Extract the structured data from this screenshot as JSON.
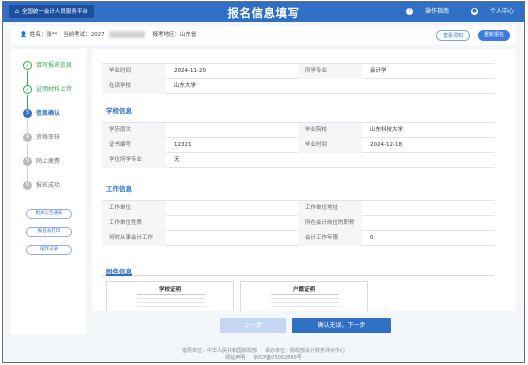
{
  "header": {
    "home_button": "全国统一会计人员服务平台",
    "title": "报名信息填写",
    "guide": "操作指南",
    "user_center": "个人中心"
  },
  "infobar": {
    "name_label": "姓名",
    "name_value": "张**",
    "exam_label": "当前考试",
    "exam_value": "2027",
    "region_label": "报考地区",
    "region_value": "山东省",
    "btn_view_tips": "查看须知",
    "btn_reapply": "重新报名"
  },
  "sidebar": {
    "steps": [
      {
        "num": "1",
        "label": "填写报名信息",
        "state": "done"
      },
      {
        "num": "2",
        "label": "证明材料上传",
        "state": "done"
      },
      {
        "num": "3",
        "label": "信息确认",
        "state": "current"
      },
      {
        "num": "4",
        "label": "资格审核",
        "state": "todo"
      },
      {
        "num": "5",
        "label": "网上缴费",
        "state": "todo"
      },
      {
        "num": "6",
        "label": "报名成功",
        "state": "todo"
      }
    ],
    "buttons": [
      "相关公告通知",
      "报名表打印",
      "操作记录"
    ]
  },
  "main": {
    "top_rows": [
      {
        "l1": "毕业时间",
        "v1": "2024-11-20",
        "l2": "所学专业",
        "v2": "会计学"
      },
      {
        "l1": "在读学校",
        "v1": "山东大学",
        "l2": "",
        "v2": ""
      }
    ],
    "school_title": "学校信息",
    "school_rows": [
      {
        "l1": "学历层次",
        "v1": "",
        "l2": "毕业院校",
        "v2": "山东科技大学"
      },
      {
        "l1": "证书编号",
        "v1": "12321",
        "l2": "毕业时间",
        "v2": "2024-12-18"
      },
      {
        "l1": "学位所学专业",
        "v1": "无",
        "l2": "",
        "v2": ""
      }
    ],
    "work_title": "工作信息",
    "work_rows": [
      {
        "l1": "工作单位",
        "v1": "",
        "l2": "工作单位地址",
        "v2": ""
      },
      {
        "l1": "工作单位性质",
        "v1": "",
        "l2": "所在会计岗位的职称",
        "v2": ""
      },
      {
        "l1": "何时从事会计工作",
        "v1": "",
        "l2": "会计工作年限",
        "v2": "0"
      }
    ],
    "attach_title": "附件信息",
    "attachments": [
      "学校证明",
      "户籍证明"
    ]
  },
  "buttons": {
    "prev": "上一步",
    "next": "确认无误，下一步"
  },
  "footer": {
    "guide_unit": "指导单位：中华人民共和国财政部",
    "host_unit": "承办单位：财政部会计财务评价中心",
    "statement": "网站声明",
    "icp": "京ICP备05002860号"
  }
}
